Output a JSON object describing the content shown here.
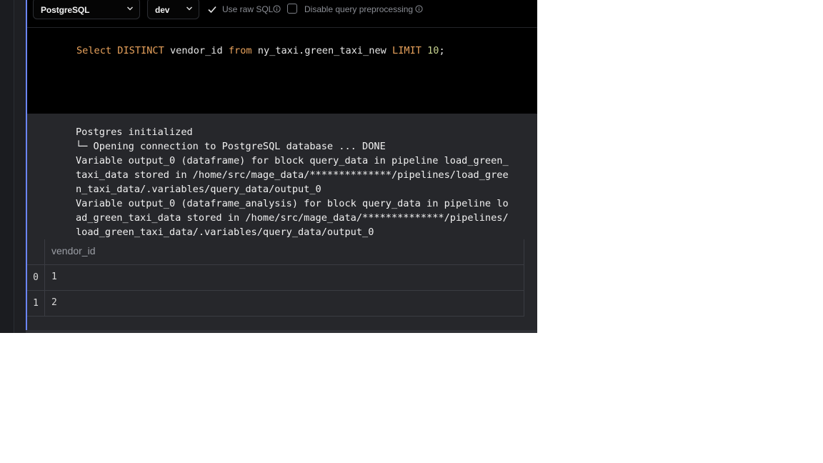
{
  "toolbar": {
    "database_select": "PostgreSQL",
    "env_select": "dev",
    "use_raw_sql_label": "Use raw SQL",
    "use_raw_sql_checked": true,
    "disable_preprocessing_label": "Disable query preprocessing",
    "disable_preprocessing_checked": false
  },
  "editor": {
    "line1": {
      "kw1": "Select",
      "kw2": "DISTINCT",
      "col": "vendor_id",
      "kw3": "from",
      "table": "ny_taxi.green_taxi_new",
      "kw4": "LIMIT",
      "num": "10",
      "end": ";"
    }
  },
  "output": {
    "log": "Postgres initialized\n└─ Opening connection to PostgreSQL database ... DONE\nVariable output_0 (dataframe) for block query_data in pipeline load_green_\ntaxi_data stored in /home/src/mage_data/**************/pipelines/load_gree\nn_taxi_data/.variables/query_data/output_0\nVariable output_0 (dataframe_analysis) for block query_data in pipeline lo\nad_green_taxi_data stored in /home/src/mage_data/**************/pipelines/\nload_green_taxi_data/.variables/query_data/output_0"
  },
  "table": {
    "columns": [
      "vendor_id"
    ],
    "rows": [
      {
        "index": "0",
        "vendor_id": "1"
      },
      {
        "index": "1",
        "vendor_id": "2"
      }
    ]
  },
  "colors": {
    "accent": "#6b85ff",
    "keyword": "#e8a25c",
    "number": "#c7d38f"
  }
}
